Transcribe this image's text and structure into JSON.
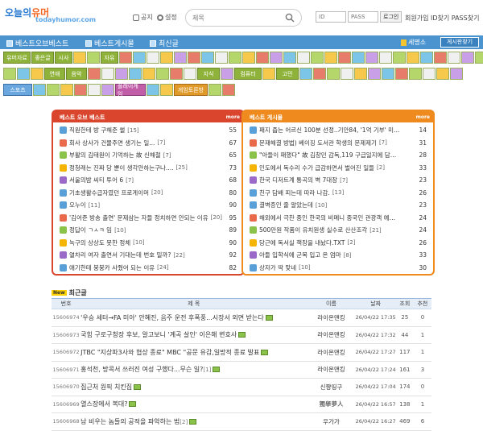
{
  "header": {
    "logo_ko": "오늘의",
    "logo_ko2": "유머",
    "logo_en": "todayhumor.com",
    "notice": "공지",
    "settings": "설정",
    "search_placeholder": "제목",
    "login_id_placeholder": "ID",
    "login_pass_placeholder": "PASS",
    "login_button": "로그인",
    "join_links": "회원가입 ID찾기 PASS찾기"
  },
  "nav": {
    "items": [
      "베스트오브베스트",
      "베스트게시물",
      "최신글"
    ],
    "hall_of_fame": "세명소",
    "board_list": "게시판찾기"
  },
  "icon_rows": {
    "row1": [
      "유머자료",
      "좋은글",
      "시사",
      "",
      "",
      "자유",
      "",
      "",
      "",
      "",
      "",
      "",
      "",
      "",
      "",
      "",
      "",
      "",
      "",
      "",
      "",
      "",
      "",
      "",
      "",
      "",
      "",
      "",
      "",
      "",
      "",
      "",
      "",
      ""
    ],
    "row2": [
      "",
      "",
      "",
      "연애",
      "음악",
      "",
      "",
      "",
      "",
      "",
      "",
      "",
      "",
      "지식",
      "",
      "컴퓨터",
      "",
      "고민",
      "",
      "",
      "",
      "",
      "",
      "",
      "",
      "",
      ""
    ],
    "row3": [
      "스포츠",
      "",
      "",
      "",
      "",
      "",
      "",
      "플레이게임",
      "",
      "",
      "게임토론방",
      "",
      ""
    ]
  },
  "best_of_best": {
    "title": "베스트 오브 베스트",
    "more": "more",
    "items": [
      {
        "title": "직원한테 방 구해준 썰",
        "comments": "[15]",
        "count": "55"
      },
      {
        "title": "회사 상사가 건물주면 생기는 일...",
        "comments": "[7]",
        "count": "67"
      },
      {
        "title": "부활의 김태원이 기억하는 故 신해철",
        "comments": "[7]",
        "count": "65"
      },
      {
        "title": "정청래는 진짜 당 뿐이 생각안하는구나....",
        "comments": "[25]",
        "count": "73"
      },
      {
        "title": "서울의밤 씨티 투어 6",
        "comments": "[7]",
        "count": "68"
      },
      {
        "title": "기초생활수급자였던 프로게이머",
        "comments": "[20]",
        "count": "80"
      },
      {
        "title": "오누이",
        "comments": "[11]",
        "count": "90"
      },
      {
        "title": "'김어준 방송 출연' 문제삼는 자들 정치하면 안되는 이유",
        "comments": "[20]",
        "count": "95"
      },
      {
        "title": "정답이 ㄱㅅㅋ 임",
        "comments": "[10]",
        "count": "89"
      },
      {
        "title": "녹구의 상상도 못한 정체",
        "comments": "[10]",
        "count": "90"
      },
      {
        "title": "열차리 여자 출연서 기대는데 번호 밀까?",
        "comments": "[22]",
        "count": "92"
      },
      {
        "title": "애기한테 붕붕카 사줬어 되는 이유",
        "comments": "[24]",
        "count": "82"
      }
    ]
  },
  "best_posts": {
    "title": "베스트 게시물",
    "more": "more",
    "items": [
      {
        "title": "패지 줍는 어르신 100분 선정..기안84, '1억 기부' 미담 터...",
        "comments": "",
        "count": "14"
      },
      {
        "title": "문재해결 방법) 베이징 도서관 학생의 문제제기",
        "comments": "[7]",
        "count": "31"
      },
      {
        "title": "\"아들이 패했다\" 故 김창민 감독,119 구급일지에 담긴 기록..",
        "comments": "",
        "count": "28"
      },
      {
        "title": "인도에서 독수리 수가 급감하면서 벌어진 일들",
        "comments": "[2]",
        "count": "33"
      },
      {
        "title": "한국 디저트계 통곡의 벽 7대장",
        "comments": "[7]",
        "count": "23"
      },
      {
        "title": "친구 담배 피는데 따라 나감.",
        "comments": "[13]",
        "count": "26"
      },
      {
        "title": "결벽증인 줄 알았는데",
        "comments": "[10]",
        "count": "23"
      },
      {
        "title": "해외에서 극찬 중인 한국의 비메니 중국인 관광객 예의 주...",
        "comments": "",
        "count": "24"
      },
      {
        "title": "500만원 작품이 유치원생 실수로 산산조각",
        "comments": "[21]",
        "count": "24"
      },
      {
        "title": "당근에 독서실 책장을 내놨다.TXT",
        "comments": "[2]",
        "count": "26"
      },
      {
        "title": "아들 입학식에 군복 입고 온 엄마",
        "comments": "[8]",
        "count": "33"
      },
      {
        "title": "상자가 딱 맞네",
        "comments": "[10]",
        "count": "30"
      }
    ]
  },
  "latest": {
    "tag": "New",
    "title": "최근글",
    "columns": [
      "번호",
      "제 목",
      "이름",
      "날짜",
      "조회",
      "추천"
    ],
    "rows": [
      {
        "no": "15606974",
        "title": "'우승 세터→FA 미아' 안혜진, 음주 운전 후폭풍...시장서 외면 받는다",
        "comments": "",
        "name": "라이온맨킹",
        "date": "26/04/22 17:35",
        "views": "25",
        "rec": "0"
      },
      {
        "no": "15606973",
        "title": "국힘 구로구청장 후보, 알고보니 '계곡 살인' 이은해 변호사",
        "comments": "",
        "name": "라이온맨킹",
        "date": "26/04/22 17:32",
        "views": "44",
        "rec": "1"
      },
      {
        "no": "15606972",
        "title": "JTBC \"지상파3사와 협상 종료\" MBC \"공문 유감,일방적 종료 발표",
        "comments": "",
        "name": "라이온맨킹",
        "date": "26/04/22 17:27",
        "views": "117",
        "rec": "1"
      },
      {
        "no": "15606971",
        "title": "홍석천, 방콕서 쓰러진 여성 구했다...무슨 일?",
        "comments": "[1]",
        "name": "라이온맨킹",
        "date": "26/04/22 17:24",
        "views": "161",
        "rec": "3"
      },
      {
        "no": "15606970",
        "title": "집근처 원픽 치킨집",
        "comments": "",
        "name": "신쨩띵구",
        "date": "26/04/22 17:04",
        "views": "174",
        "rec": "0"
      },
      {
        "no": "15606969",
        "title": "열스장에서 복대?",
        "comments": "",
        "name": "獨擧夢人",
        "date": "26/04/22 16:57",
        "views": "138",
        "rec": "1"
      },
      {
        "no": "15606968",
        "title": "남 비우는 놈들의 공적을 파악하는 법",
        "comments": "[2]",
        "name": "우가가",
        "date": "26/04/22 16:27",
        "views": "469",
        "rec": "6"
      }
    ]
  },
  "colors": {
    "nav": "#4b94d0",
    "best_of_best": "#d9452d",
    "best_posts": "#ee8a1e",
    "icon_green": "#8fb33a"
  }
}
